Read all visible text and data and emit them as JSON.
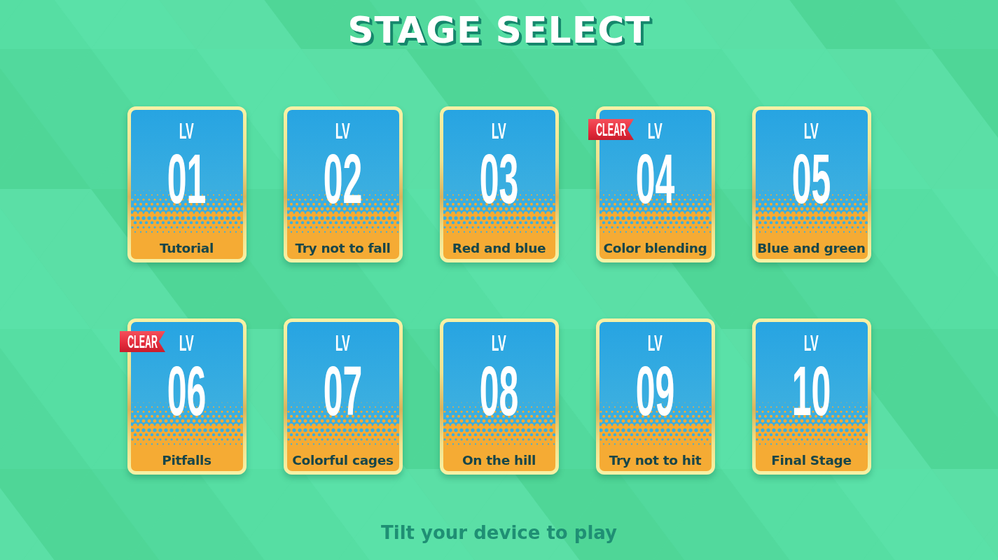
{
  "title": "STAGE SELECT",
  "stages": [
    {
      "prefix": "LV",
      "number": "01",
      "name": "Tutorial",
      "cleared": false
    },
    {
      "prefix": "LV",
      "number": "02",
      "name": "Try not to fall",
      "cleared": false
    },
    {
      "prefix": "LV",
      "number": "03",
      "name": "Red and blue",
      "cleared": false
    },
    {
      "prefix": "LV",
      "number": "04",
      "name": "Color blending",
      "cleared": true,
      "badge": "CLEAR"
    },
    {
      "prefix": "LV",
      "number": "05",
      "name": "Blue and green",
      "cleared": false
    },
    {
      "prefix": "LV",
      "number": "06",
      "name": "Pitfalls",
      "cleared": true,
      "badge": "CLEAR"
    },
    {
      "prefix": "LV",
      "number": "07",
      "name": "Colorful cages",
      "cleared": false
    },
    {
      "prefix": "LV",
      "number": "08",
      "name": "On the hill",
      "cleared": false
    },
    {
      "prefix": "LV",
      "number": "09",
      "name": "Try not to hit",
      "cleared": false
    },
    {
      "prefix": "LV",
      "number": "10",
      "name": "Final Stage",
      "cleared": false
    }
  ],
  "hint": "Tilt your device to play"
}
